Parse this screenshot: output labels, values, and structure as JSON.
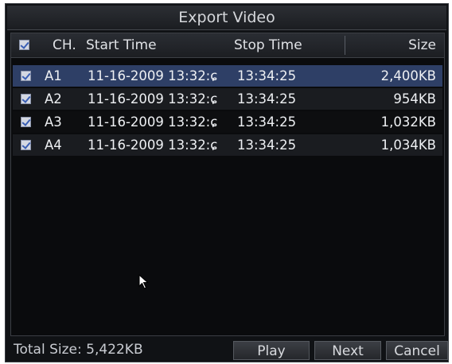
{
  "dialog": {
    "title": "Export Video"
  },
  "table": {
    "headers": {
      "channel": "CH.",
      "start": "Start Time",
      "stop": "Stop Time",
      "size": "Size"
    },
    "rows": [
      {
        "ch": "A1",
        "start": "11-16-2009 13:32:ɕ",
        "stop": "13:34:25",
        "size": "2,400KB",
        "checked": true
      },
      {
        "ch": "A2",
        "start": "11-16-2009 13:32:ɕ",
        "stop": "13:34:25",
        "size": "954KB",
        "checked": true
      },
      {
        "ch": "A3",
        "start": "11-16-2009 13:32:ɕ",
        "stop": "13:34:25",
        "size": "1,032KB",
        "checked": true
      },
      {
        "ch": "A4",
        "start": "11-16-2009 13:32:ɕ",
        "stop": "13:34:25",
        "size": "1,034KB",
        "checked": true
      }
    ]
  },
  "footer": {
    "total_size": "Total Size: 5,422KB",
    "play_label": "Play",
    "next_label": "Next",
    "cancel_label": "Cancel"
  }
}
